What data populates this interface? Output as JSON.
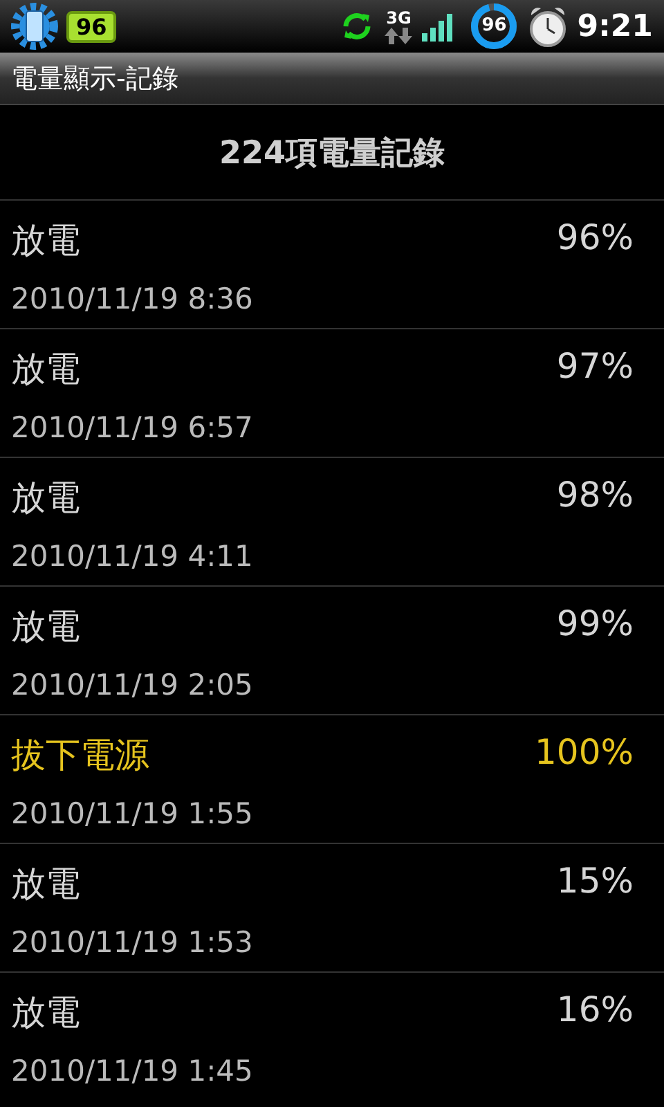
{
  "status_bar": {
    "battery_badge": "96",
    "network": "3G",
    "battery_ring": {
      "text": "96",
      "level": 0.96
    },
    "time": "9:21"
  },
  "title_bar": {
    "title": "電量顯示-記錄"
  },
  "header": "224項電量記錄",
  "records": [
    {
      "kind": "discharge",
      "event": "放電",
      "percent": "96%",
      "time": "2010/11/19  8:36"
    },
    {
      "kind": "discharge",
      "event": "放電",
      "percent": "97%",
      "time": "2010/11/19  6:57"
    },
    {
      "kind": "discharge",
      "event": "放電",
      "percent": "98%",
      "time": "2010/11/19  4:11"
    },
    {
      "kind": "discharge",
      "event": "放電",
      "percent": "99%",
      "time": "2010/11/19  2:05"
    },
    {
      "kind": "unplugged",
      "event": "拔下電源",
      "percent": "100%",
      "time": "2010/11/19  1:55"
    },
    {
      "kind": "discharge",
      "event": "放電",
      "percent": "15%",
      "time": "2010/11/19  1:53"
    },
    {
      "kind": "discharge",
      "event": "放電",
      "percent": "16%",
      "time": "2010/11/19  1:45"
    }
  ]
}
